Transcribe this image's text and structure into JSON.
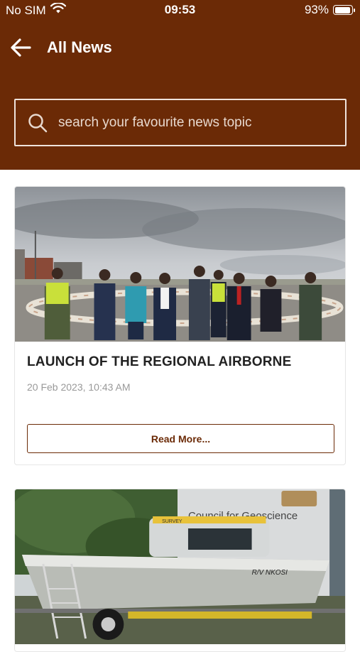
{
  "status_bar": {
    "carrier": "No SIM",
    "time": "09:53",
    "battery": "93%",
    "battery_level": 0.93
  },
  "header": {
    "title": "All News"
  },
  "search": {
    "placeholder": "search your favourite news topic"
  },
  "news": [
    {
      "title": "LAUNCH OF THE REGIONAL AIRBORNE",
      "date": "20 Feb 2023, 10:43 AM",
      "button": "Read More..."
    },
    {
      "image_text": [
        "Council for Geoscience",
        "SURVEY",
        "R/V NKOSI"
      ]
    }
  ],
  "colors": {
    "brand": "#6b2a06"
  }
}
